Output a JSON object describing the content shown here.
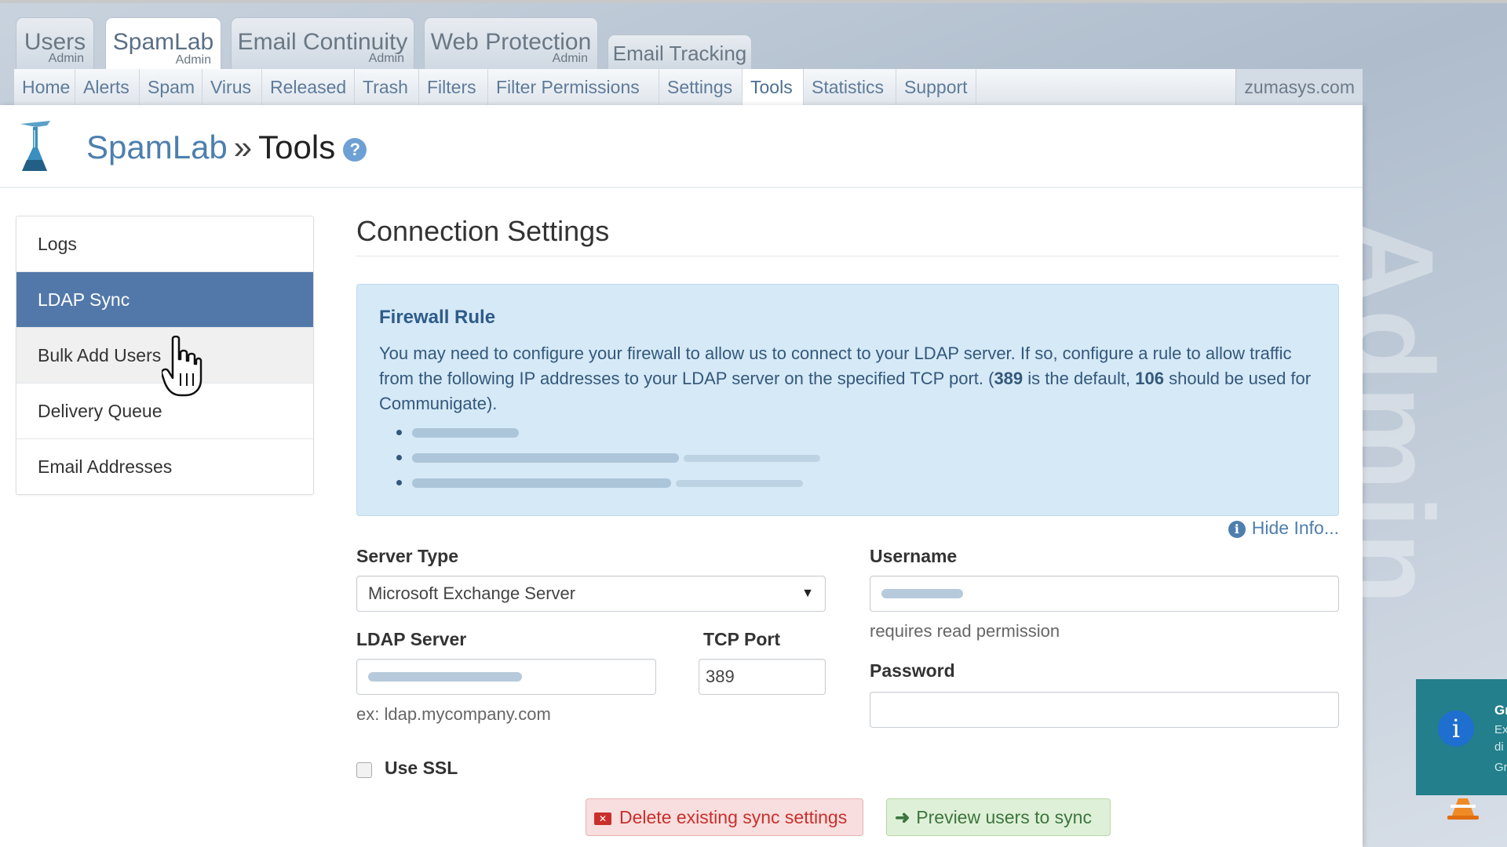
{
  "product_tabs": [
    {
      "label": "Users",
      "sub": "Admin"
    },
    {
      "label": "SpamLab",
      "sub": "Admin"
    },
    {
      "label": "Email Continuity",
      "sub": "Admin"
    },
    {
      "label": "Web Protection",
      "sub": "Admin"
    },
    {
      "label": "Email Tracking",
      "sub": ""
    }
  ],
  "subnav": {
    "items": [
      "Home",
      "Alerts",
      "Spam",
      "Virus",
      "Released",
      "Trash",
      "Filters",
      "Filter Permissions",
      "Settings",
      "Tools",
      "Statistics",
      "Support"
    ],
    "active": "Tools",
    "domain": "zumasys.com"
  },
  "header": {
    "app": "SpamLab",
    "separator": "»",
    "page": "Tools",
    "help_glyph": "?"
  },
  "side_menu": {
    "items": [
      "Logs",
      "LDAP Sync",
      "Bulk Add Users",
      "Delivery Queue",
      "Email Addresses"
    ],
    "active": "LDAP Sync"
  },
  "content": {
    "title": "Connection Settings",
    "info": {
      "heading": "Firewall Rule",
      "text_1": "You may need to configure your firewall to allow us to connect to your LDAP server. If so, configure a rule to allow traffic from the following IP addresses to your LDAP server on the specified TCP port. (",
      "port_default": "389",
      "text_2": " is the default, ",
      "port_communigate": "106",
      "text_3": " should be used for Communigate)."
    },
    "hide_info": "Hide Info...",
    "server_type": {
      "label": "Server Type",
      "value": "Microsoft Exchange Server"
    },
    "username": {
      "label": "Username",
      "hint": "requires read permission"
    },
    "ldap_server": {
      "label": "LDAP Server",
      "hint": "ex: ldap.mycompany.com"
    },
    "tcp_port": {
      "label": "TCP Port",
      "value": "389"
    },
    "password": {
      "label": "Password",
      "value": ""
    },
    "use_ssl": {
      "label": "Use SSL",
      "checked": false
    },
    "buttons": {
      "delete": "Delete existing sync settings",
      "preview": "Preview users to sync"
    }
  },
  "watermark": "Admin",
  "toast": {
    "title": "Gr",
    "line1": "Ex",
    "line2": "di",
    "line3": "Gr"
  },
  "colors": {
    "accent": "#5278aa",
    "link": "#4d7fae",
    "info_bg": "#d6e9f6",
    "danger": "#c9302c",
    "success": "#3c763d",
    "toast_bg": "#237f8c"
  }
}
